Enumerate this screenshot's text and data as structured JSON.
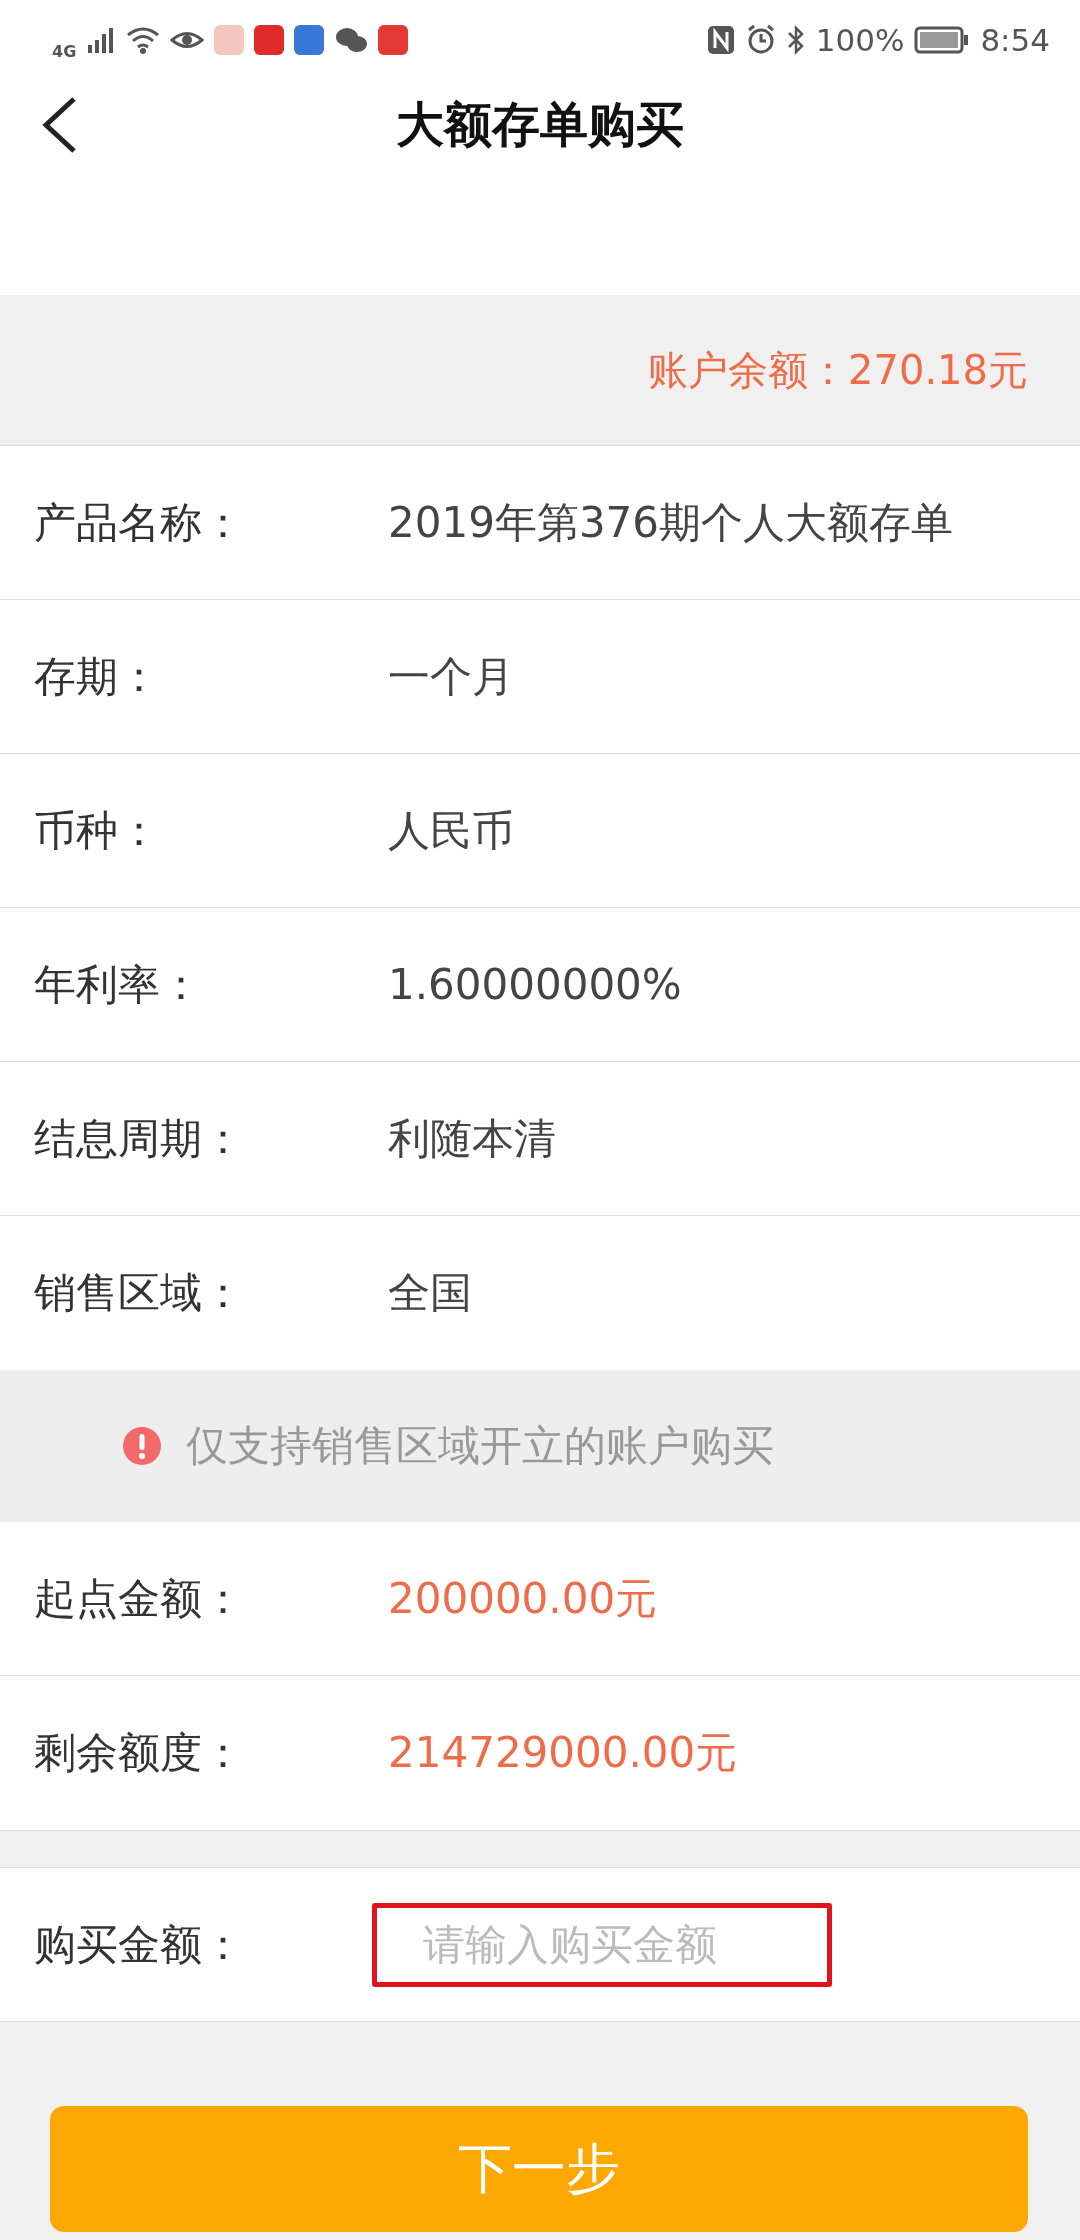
{
  "status_bar": {
    "network": "4G",
    "battery": "100%",
    "time": "8:54"
  },
  "header": {
    "title": "大额存单购买"
  },
  "balance": "账户余额：270.18元",
  "details": [
    {
      "label": "产品名称：",
      "value": "2019年第376期个人大额存单"
    },
    {
      "label": "存期：",
      "value": "一个月"
    },
    {
      "label": "币种：",
      "value": "人民币"
    },
    {
      "label": "年利率：",
      "value": "1.60000000%"
    },
    {
      "label": "结息周期：",
      "value": "利随本清"
    },
    {
      "label": "销售区域：",
      "value": "全国"
    }
  ],
  "notice": "仅支持销售区域开立的账户购买",
  "limits": [
    {
      "label": "起点金额：",
      "value": "200000.00元"
    },
    {
      "label": "剩余额度：",
      "value": "214729000.00元"
    }
  ],
  "purchase": {
    "label": "购买金额：",
    "placeholder": "请输入购买金额"
  },
  "next_button": "下一步"
}
